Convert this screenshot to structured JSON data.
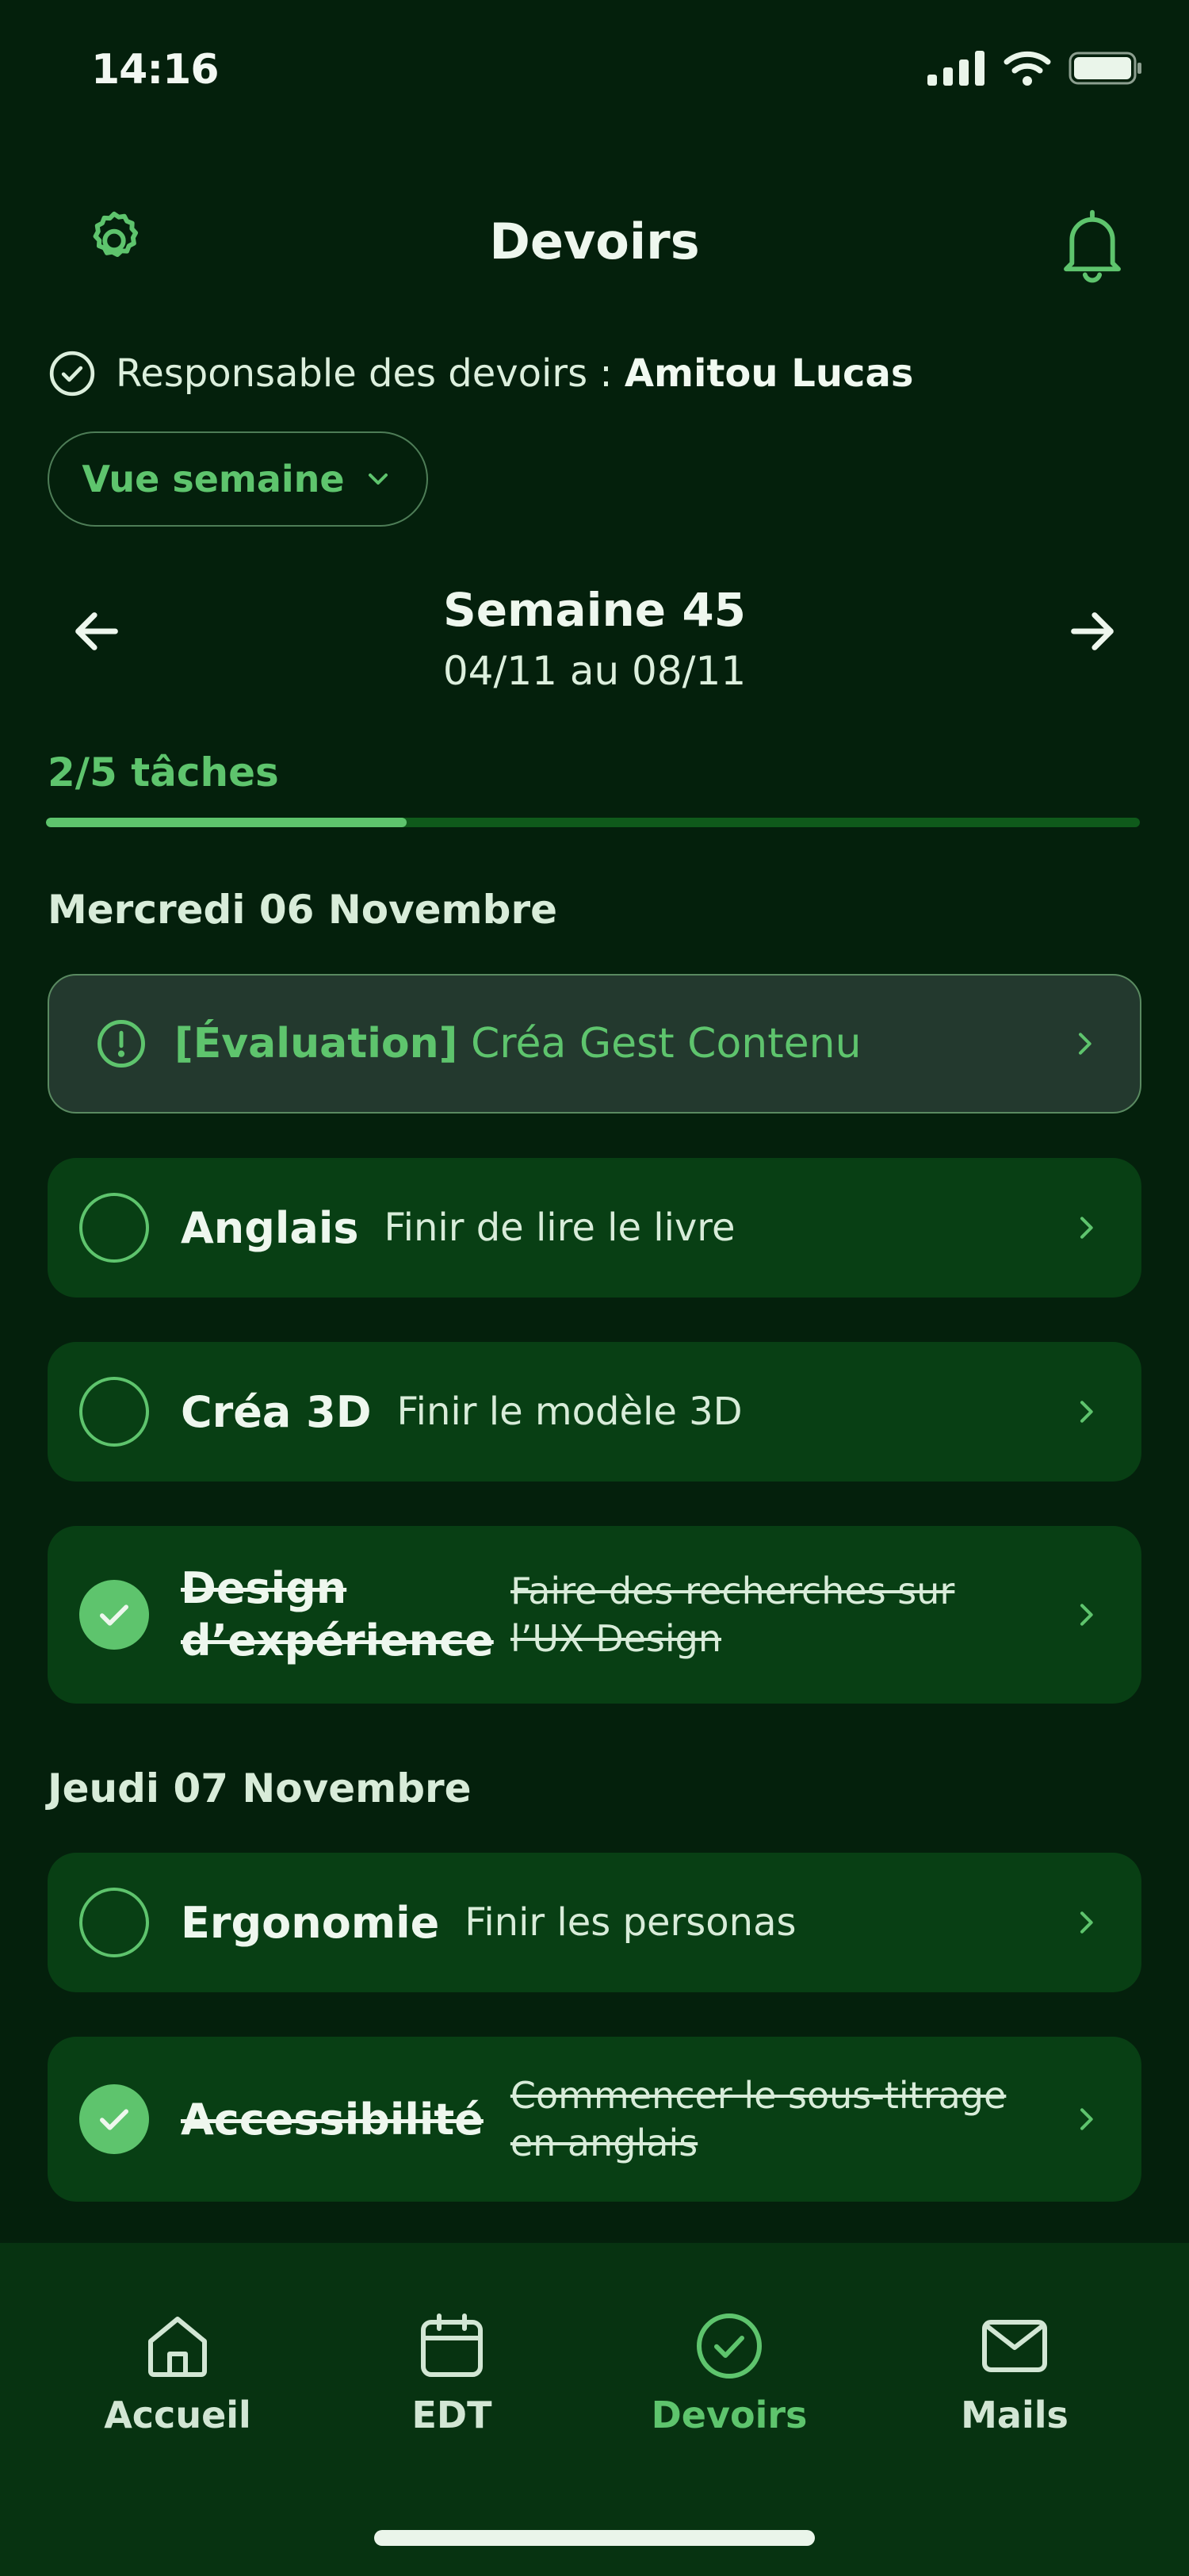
{
  "status_bar": {
    "time": "14:16"
  },
  "header": {
    "title": "Devoirs"
  },
  "responsible": {
    "label": "Responsable des devoirs :",
    "name": "Amitou Lucas"
  },
  "view_selector": {
    "label": "Vue semaine"
  },
  "week": {
    "title": "Semaine 45",
    "range": "04/11 au 08/11"
  },
  "progress": {
    "label": "2/5 tâches",
    "fraction": 0.33
  },
  "days": [
    {
      "heading": "Mercredi 06 Novembre",
      "tasks": [
        {
          "type": "evaluation",
          "tag": "[Évaluation]",
          "description": "Créa Gest Contenu"
        },
        {
          "subject": "Anglais",
          "description": "Finir de lire le livre",
          "done": false
        },
        {
          "subject": "Créa 3D",
          "description": "Finir le modèle 3D",
          "done": false
        },
        {
          "subject": "Design d’expérience",
          "description": "Faire des recherches sur l’UX Design",
          "done": true
        }
      ]
    },
    {
      "heading": "Jeudi 07 Novembre",
      "tasks": [
        {
          "subject": "Ergonomie",
          "description": "Finir les personas",
          "done": false
        },
        {
          "subject": "Accessibilité",
          "description": "Commencer le sous-titrage en anglais",
          "done": true
        }
      ]
    }
  ],
  "tabbar": {
    "items": [
      {
        "label": "Accueil",
        "icon": "home-icon"
      },
      {
        "label": "EDT",
        "icon": "calendar-icon"
      },
      {
        "label": "Devoirs",
        "icon": "check-circle-icon",
        "active": true
      },
      {
        "label": "Mails",
        "icon": "mail-icon"
      }
    ]
  },
  "colors": {
    "background": "#04200c",
    "accent": "#5ec46d",
    "card": "#083f14",
    "tabbar": "#073311"
  }
}
